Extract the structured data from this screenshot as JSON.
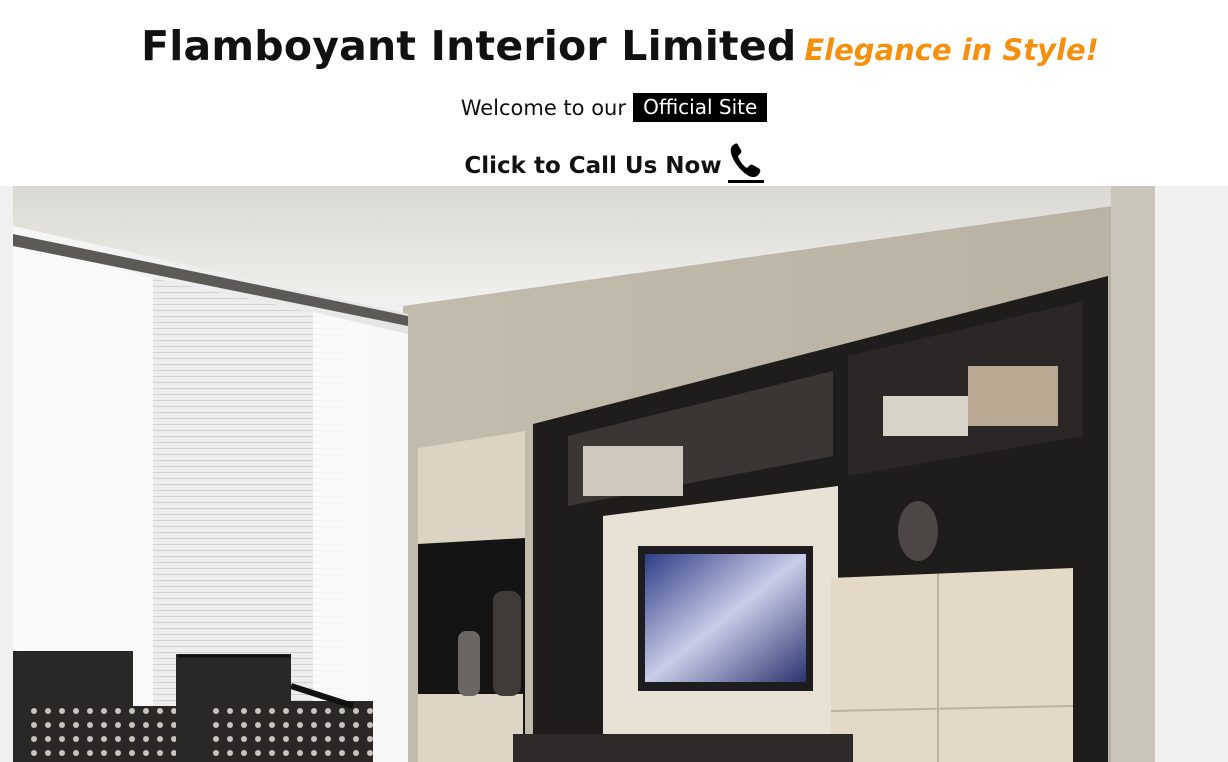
{
  "header": {
    "title": "Flamboyant Interior Limited",
    "tagline": "Elegance in Style!",
    "welcome_text": "Welcome to our",
    "official_badge": "Official Site",
    "call_label": "Click to Call Us Now",
    "call_icon": "phone-icon",
    "tagline_color": "#f5900e"
  },
  "hero": {
    "image_icon": "living-room-photo"
  }
}
